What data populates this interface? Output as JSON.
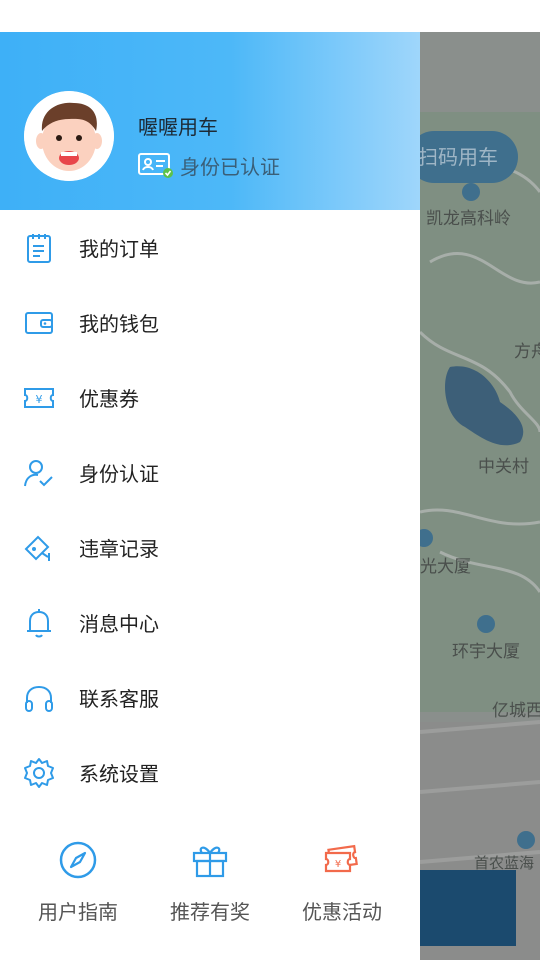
{
  "user": {
    "name": "喔喔用车",
    "verified_text": "身份已认证"
  },
  "menu": [
    {
      "label": "我的订单",
      "icon": "order-icon"
    },
    {
      "label": "我的钱包",
      "icon": "wallet-icon"
    },
    {
      "label": "优惠券",
      "icon": "coupon-icon"
    },
    {
      "label": "身份认证",
      "icon": "identity-icon"
    },
    {
      "label": "违章记录",
      "icon": "camera-icon"
    },
    {
      "label": "消息中心",
      "icon": "bell-icon"
    },
    {
      "label": "联系客服",
      "icon": "headphones-icon"
    },
    {
      "label": "系统设置",
      "icon": "gear-icon"
    }
  ],
  "bottom": [
    {
      "label": "用户指南",
      "icon": "compass-icon"
    },
    {
      "label": "推荐有奖",
      "icon": "gift-icon"
    },
    {
      "label": "优惠活动",
      "icon": "ticket-icon"
    }
  ],
  "map": {
    "scan_button": "扫码用车",
    "labels": [
      "凯龙高科岭",
      "方舟",
      "中关村",
      "光大厦",
      "环宇大厦",
      "亿城西",
      "首农蓝海"
    ]
  },
  "colors": {
    "accent": "#3eb0f7",
    "icon_blue": "#2f9be8",
    "ticket_orange": "#f26a4b",
    "verify_green": "#5cc24a"
  }
}
